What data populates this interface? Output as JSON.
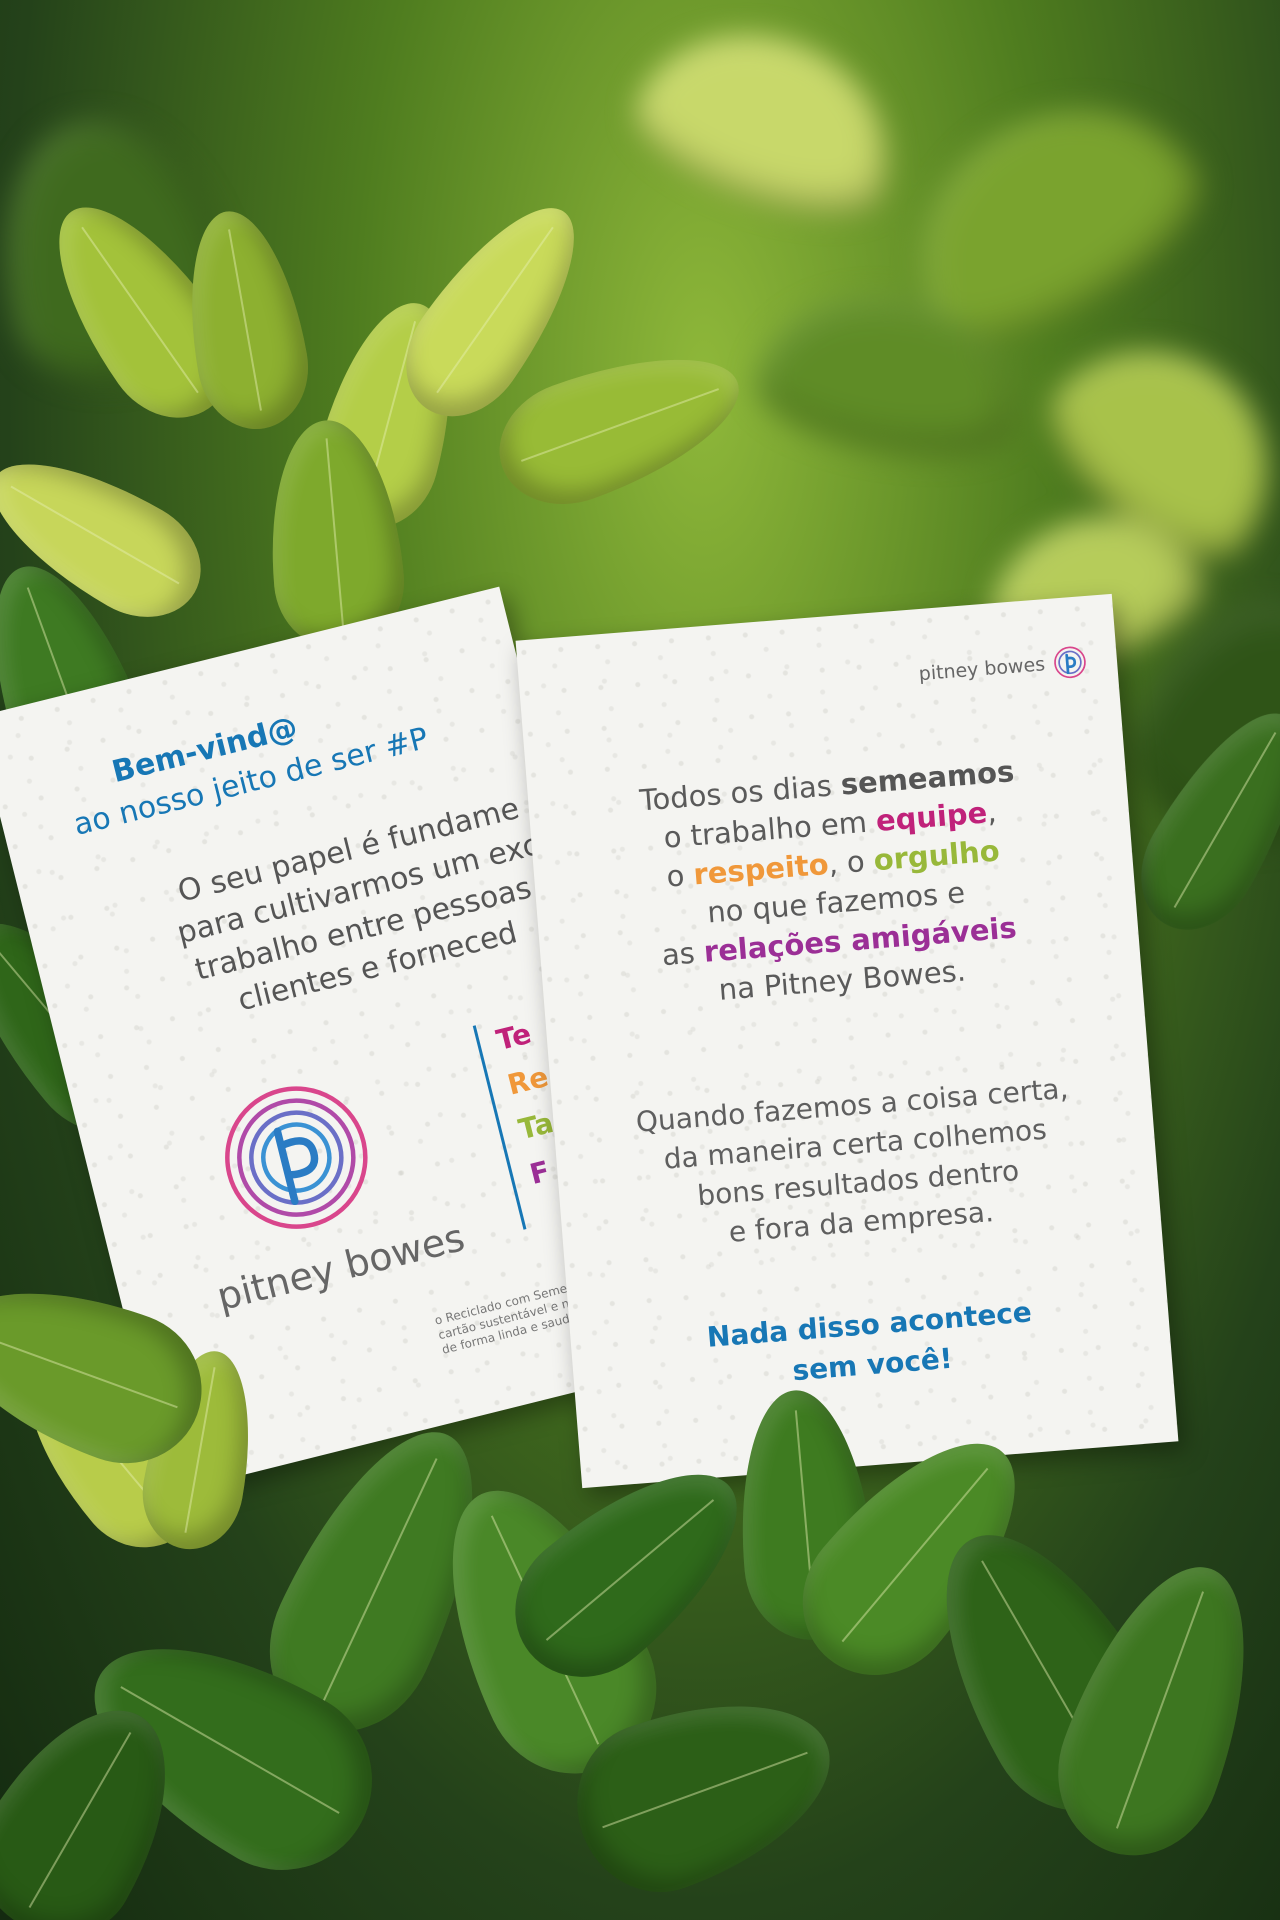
{
  "back_card": {
    "welcome": "Bem-vind@",
    "subtitle": "ao nosso jeito de ser #P",
    "body_lines": [
      "O seu papel é fundame",
      "para cultivarmos um exc",
      "trabalho entre pessoas,",
      "clientes e forneced"
    ],
    "brand": "pitney bowes",
    "values": [
      {
        "text": "Te",
        "color": "#c0227a"
      },
      {
        "text": "Re",
        "color": "#f0983a"
      },
      {
        "text": "Ta",
        "color": "#98b83a"
      },
      {
        "text": "F",
        "color": "#9b2f96"
      }
    ],
    "fine_print_lines": [
      "o Reciclado com Sement",
      "cartão sustentável e mist",
      "de forma linda e saudável"
    ]
  },
  "front_card": {
    "brand": "pitney bowes",
    "poem": {
      "line1_a": "Todos os dias ",
      "line1_b": "semeamos",
      "line2_a": "o trabalho em ",
      "line2_b": "equipe",
      "line2_c": ",",
      "line3_a": "o ",
      "line3_b": "respeito",
      "line3_c": ", o ",
      "line3_d": "orgulho",
      "line4": "no que fazemos e",
      "line5_a": "as ",
      "line5_b": "relações amigáveis",
      "line6": "na Pitney Bowes."
    },
    "paragraph2_lines": [
      "Quando fazemos a coisa certa,",
      "da maneira certa colhemos",
      "bons resultados dentro",
      "e fora da empresa."
    ],
    "closing_lines": [
      "Nada disso acontece",
      "sem você!"
    ]
  },
  "colors": {
    "brand_blue": "#1777b5",
    "equipe": "#c0227a",
    "respeito": "#f0983a",
    "orgulho": "#98b83a",
    "relacoes": "#9b2f96"
  }
}
